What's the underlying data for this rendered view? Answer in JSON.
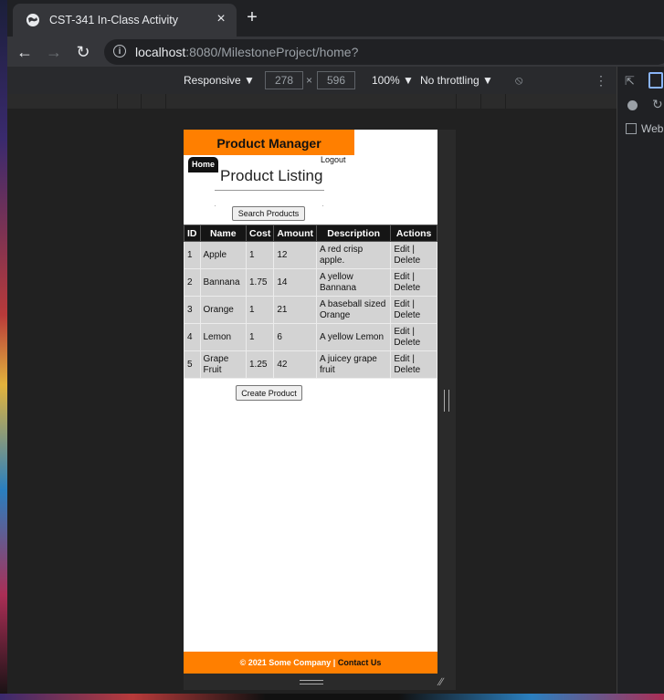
{
  "browser": {
    "tab_title": "CST-341 In-Class Activity",
    "tab_close": "×",
    "new_tab": "+",
    "url_host": "localhost",
    "url_rest": ":8080/MilestoneProject/home?"
  },
  "devtools": {
    "device_mode": "Responsive ▼",
    "width": "278",
    "height": "596",
    "times": "×",
    "zoom": "100% ▼",
    "throttling": "No throttling ▼",
    "panel_label": "Web"
  },
  "page": {
    "brand": "Product Manager",
    "home_label": "Home",
    "logout_label": "Logout",
    "title": "Product Listing",
    "search_button": "Search Products",
    "table": {
      "headers": [
        "ID",
        "Name",
        "Cost",
        "Amount",
        "Description",
        "Actions"
      ],
      "rows": [
        {
          "id": "1",
          "name": "Apple",
          "cost": "1",
          "amount": "12",
          "description": "A red crisp apple.",
          "edit": "Edit",
          "delete": "Delete"
        },
        {
          "id": "2",
          "name": "Bannana",
          "cost": "1.75",
          "amount": "14",
          "description": "A yellow Bannana",
          "edit": "Edit",
          "delete": "Delete"
        },
        {
          "id": "3",
          "name": "Orange",
          "cost": "1",
          "amount": "21",
          "description": "A baseball sized Orange",
          "edit": "Edit",
          "delete": "Delete"
        },
        {
          "id": "4",
          "name": "Lemon",
          "cost": "1",
          "amount": "6",
          "description": "A yellow Lemon",
          "edit": "Edit",
          "delete": "Delete"
        },
        {
          "id": "5",
          "name": "Grape Fruit",
          "cost": "1.25",
          "amount": "42",
          "description": "A juicey grape fruit",
          "edit": "Edit",
          "delete": "Delete"
        }
      ]
    },
    "create_button": "Create Product",
    "footer_text": "© 2021 Some Company | ",
    "footer_link": "Contact Us"
  },
  "colors": {
    "accent": "#ff7f00",
    "header_bg": "#151515",
    "row_bg": "#d3d3d3"
  },
  "icons": [
    "globe-icon",
    "close-icon",
    "plus-icon",
    "back-icon",
    "forward-icon",
    "reload-icon",
    "info-icon",
    "rotate-icon",
    "kebab-icon",
    "inspect-icon",
    "device-icon"
  ]
}
